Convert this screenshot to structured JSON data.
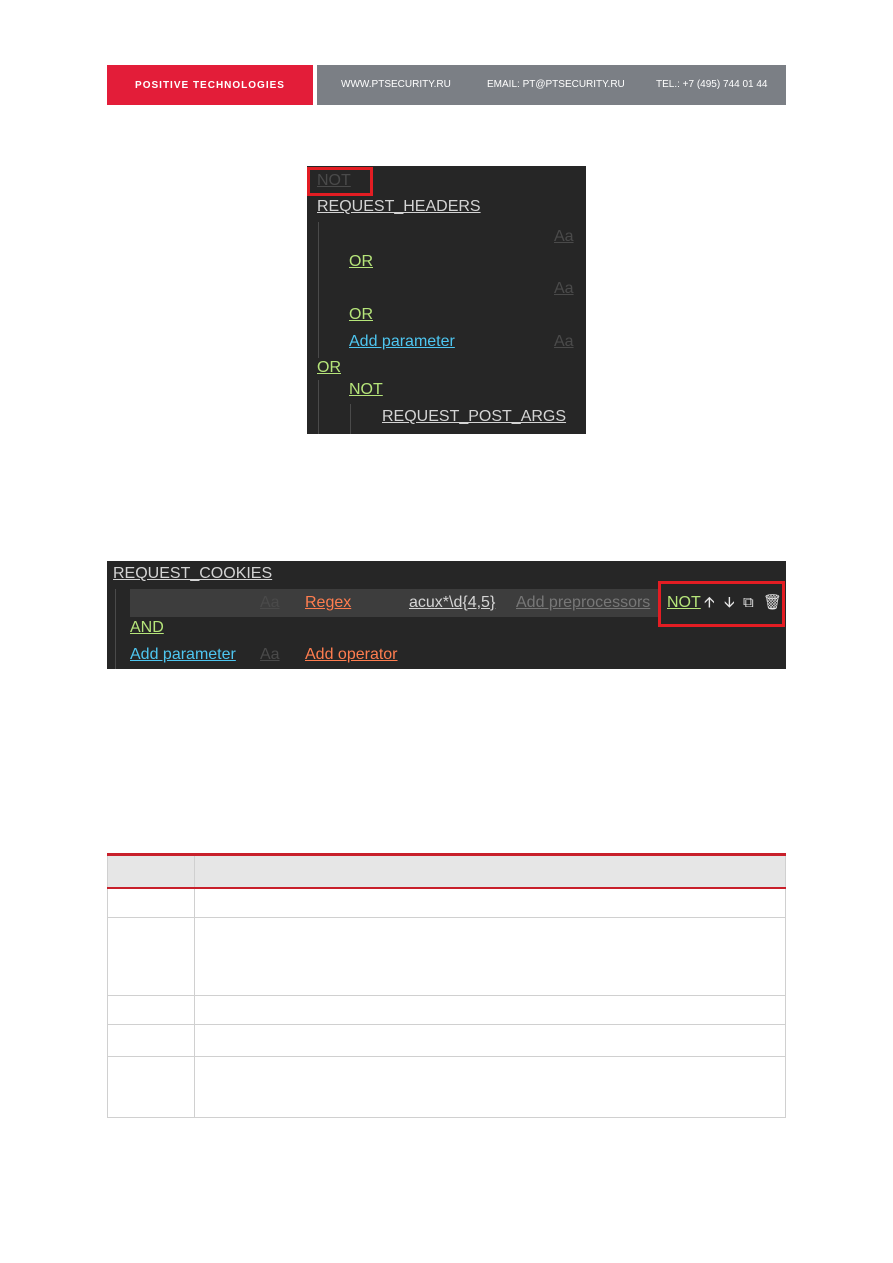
{
  "banner": {
    "brand": "POSITIVE TECHNOLOGIES",
    "website": "WWW.PTSECURITY.RU",
    "email": "EMAIL: PT@PTSECURITY.RU",
    "phone": "TEL.: +7 (495) 744 01 44",
    "brand_color": "#e31d39"
  },
  "rule_editor_1": {
    "not_root": "NOT",
    "target": "REQUEST_HEADERS",
    "case_1": "Aa",
    "or_1": "OR",
    "case_2": "Aa",
    "or_2": "OR",
    "add_parameter": "Add parameter",
    "case_3": "Aa",
    "or_outer": "OR",
    "not_inner": "NOT",
    "target_2": "REQUEST_POST_ARGS"
  },
  "rule_editor_2": {
    "target": "REQUEST_COOKIES",
    "case": "Aa",
    "operator": "Regex",
    "value": "acux*\\d{4,5}",
    "add_preprocessors": "Add preprocessors",
    "not": "NOT",
    "and": "AND",
    "add_parameter": "Add parameter",
    "case_2": "Aa",
    "add_operator": "Add operator",
    "icons": [
      "arrow-up-icon",
      "arrow-down-icon",
      "copy-icon",
      "trash-icon"
    ]
  },
  "link": "",
  "table": {
    "headers": [
      "",
      ""
    ],
    "rows": [
      [
        "",
        ""
      ],
      [
        "",
        ""
      ],
      [
        "",
        ""
      ],
      [
        "",
        ""
      ],
      [
        "",
        ""
      ]
    ]
  }
}
